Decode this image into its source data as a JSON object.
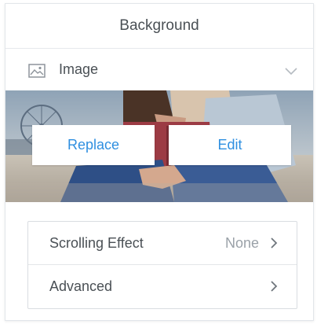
{
  "header": {
    "title": "Background"
  },
  "media": {
    "type_label": "Image",
    "icon": "image-icon",
    "dropdown_icon": "chevron-down-icon"
  },
  "actions": {
    "replace_label": "Replace",
    "edit_label": "Edit"
  },
  "settings": {
    "scrolling_effect": {
      "label": "Scrolling Effect",
      "value": "None"
    },
    "advanced": {
      "label": "Advanced"
    }
  },
  "colors": {
    "accent": "#2f8fe0",
    "text": "#4a5055",
    "muted": "#9aa1a8",
    "border": "#d9dde1"
  }
}
